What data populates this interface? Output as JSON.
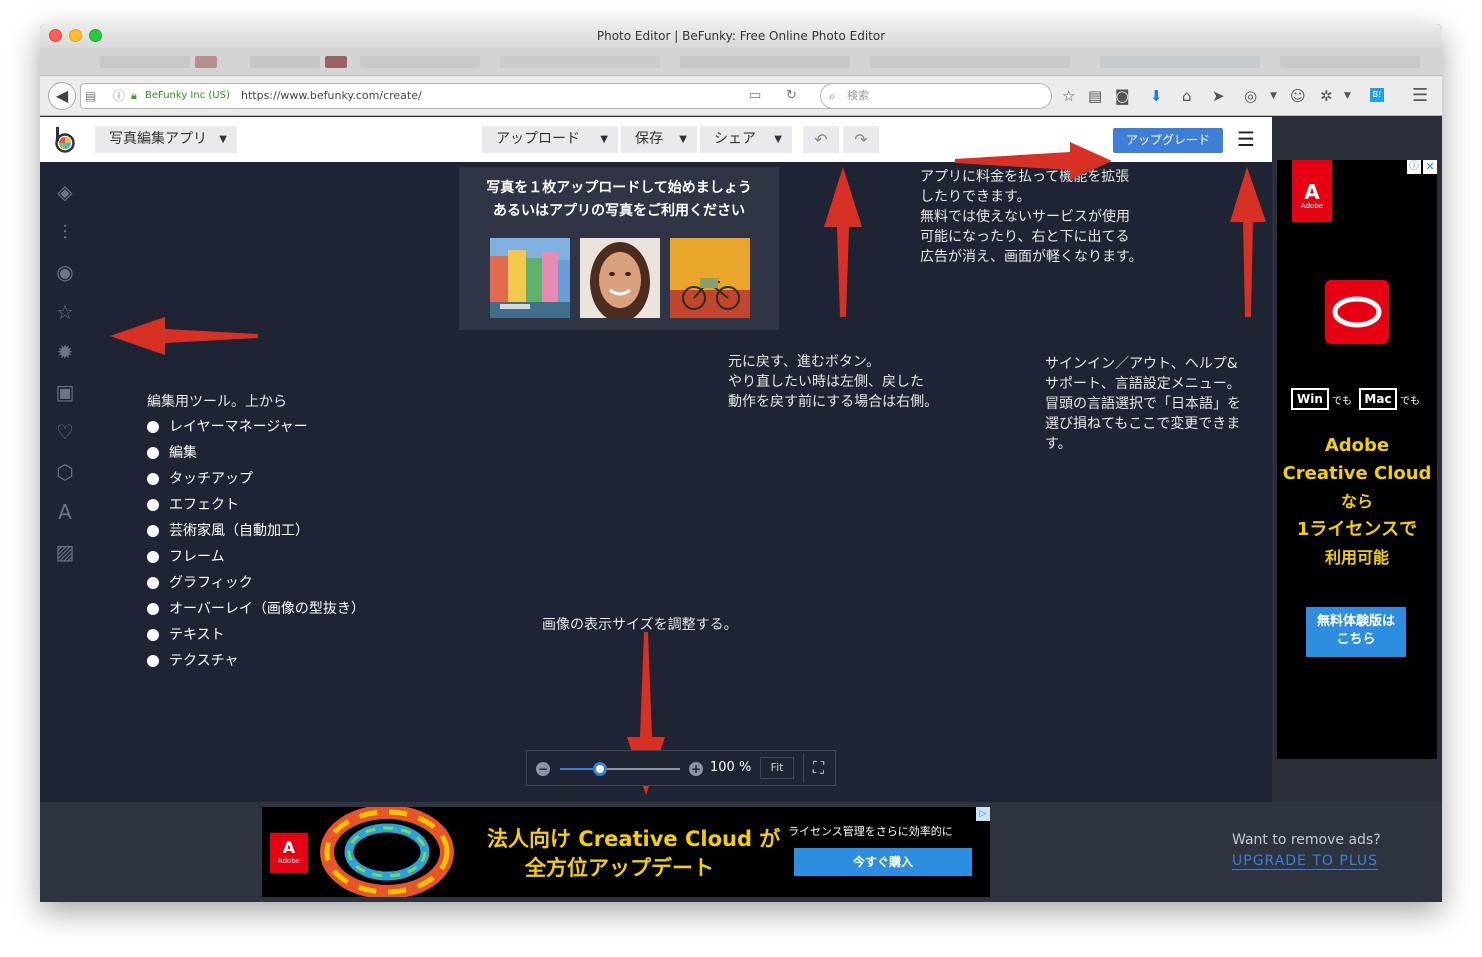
{
  "browser": {
    "window_title": "Photo Editor | BeFunky: Free Online Photo Editor",
    "site_identity": "BeFunky Inc (US)",
    "url": "https://www.befunky.com/create/",
    "search_placeholder": "検索"
  },
  "app": {
    "app_menu_label": "写真編集アプリ",
    "upload_label": "アップロード",
    "save_label": "保存",
    "share_label": "シェア",
    "upgrade_label": "アップグレード",
    "icons": [
      "layers-icon",
      "sliders-icon",
      "eye-icon",
      "star-icon",
      "gear-icon",
      "frame-icon",
      "heart-icon",
      "badge-icon",
      "text-icon",
      "texture-icon"
    ]
  },
  "upload_popup": {
    "line1": "写真を１枚アップロードして始めましょう",
    "line2": "あるいはアプリの写真をご利用ください"
  },
  "annotations": {
    "upgrade_note": [
      "アプリに料金を払って機能を拡張",
      "したりできます。",
      "無料では使えないサービスが使用",
      "可能になったり、右と下に出てる",
      "広告が消え、画面が軽くなります。"
    ],
    "undo_note": [
      "元に戻す、進むボタン。",
      "やり直したい時は左側、戻した",
      "動作を戻す前にする場合は右側。"
    ],
    "menu_note": [
      "サインイン／アウト、ヘルプ&",
      "サポート、言語設定メニュー。",
      "冒頭の言語選択で「日本語」を",
      "選び損ねてもここで変更できま",
      "す。"
    ],
    "zoom_note": "画像の表示サイズを調整する。",
    "tools_title": "編集用ツール。上から",
    "tools": [
      "レイヤーマネージャー",
      "編集",
      "タッチアップ",
      "エフェクト",
      "芸術家風（自動加工）",
      "フレーム",
      "グラフィック",
      "オーバーレイ（画像の型抜き）",
      "テキスト",
      "テクスチャ"
    ]
  },
  "zoom": {
    "value": "100 %",
    "fit_label": "Fit",
    "slider_level": 0.33
  },
  "ad_right": {
    "brand": "Adobe",
    "win": "Win",
    "mac": "Mac",
    "demo": "でも",
    "headline1": "Adobe",
    "headline2": "Creative Cloud",
    "headline3": "なら",
    "headline4": "1ライセンスで",
    "headline5": "利用可能",
    "cta_line1": "無料体験版は",
    "cta_line2": "こちら"
  },
  "ad_bottom": {
    "brand": "Adobe",
    "headline1": "法人向け Creative Cloud が",
    "headline2": "全方位アップデート",
    "sub": "ライセンス管理をさらに効率的に",
    "cta": "今すぐ購入"
  },
  "remove_ads": {
    "question": "Want to remove ads?",
    "link": "UPGRADE TO PLUS"
  },
  "colors": {
    "canvas_bg": "#1e2433",
    "upgrade_btn": "#3d7fd6",
    "arrow_red": "#d93025",
    "ad_yellow": "#f5d000",
    "cta_blue": "#2d8de0"
  }
}
